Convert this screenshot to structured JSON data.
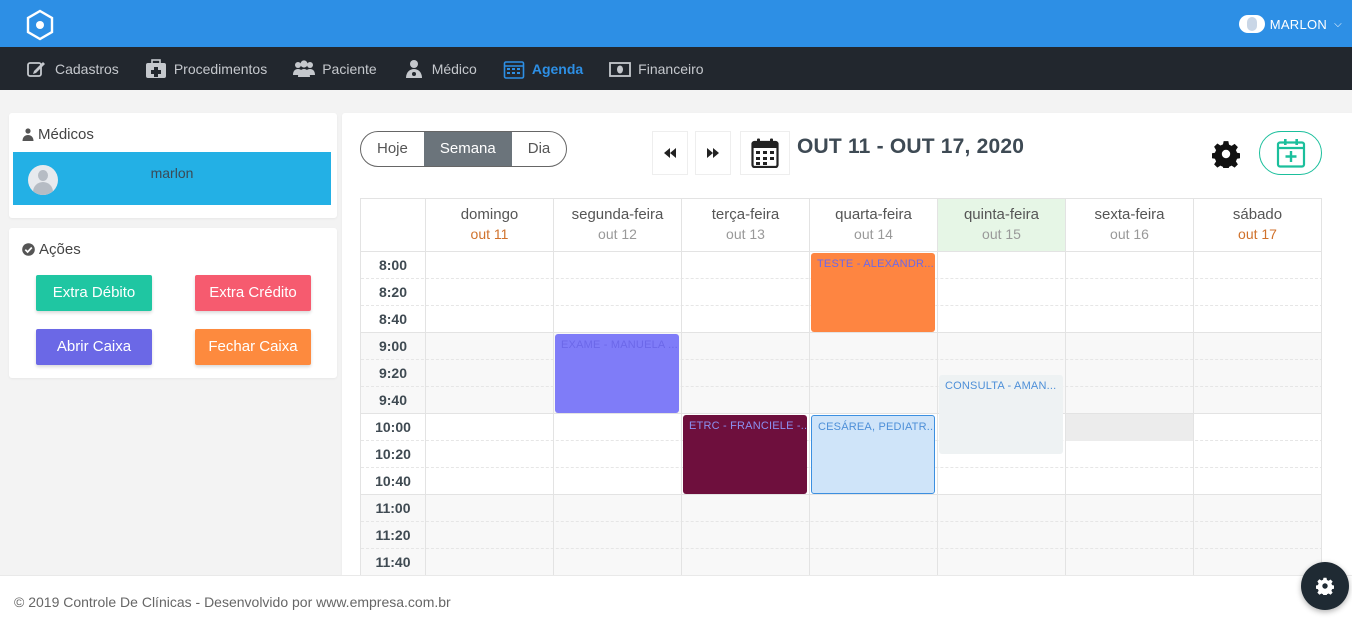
{
  "user": {
    "name": "MARLON"
  },
  "nav": [
    {
      "label": "Cadastros",
      "icon": "edit-icon"
    },
    {
      "label": "Procedimentos",
      "icon": "medkit-icon"
    },
    {
      "label": "Paciente",
      "icon": "users-icon"
    },
    {
      "label": "Médico",
      "icon": "doctor-icon"
    },
    {
      "label": "Agenda",
      "icon": "calendar-icon",
      "active": true
    },
    {
      "label": "Financeiro",
      "icon": "money-icon"
    }
  ],
  "medicos": {
    "title": "Médicos",
    "selected": "marlon"
  },
  "acoes": {
    "title": "Ações",
    "buttons": [
      {
        "label": "Extra Débito",
        "color": "#1fc6a2"
      },
      {
        "label": "Extra Crédito",
        "color": "#f65b6f"
      },
      {
        "label": "Abrir Caixa",
        "color": "#6b68e6"
      },
      {
        "label": "Fechar Caixa",
        "color": "#fd8a3e"
      }
    ]
  },
  "calendar": {
    "views": [
      "Hoje",
      "Semana",
      "Dia"
    ],
    "active_view": "Semana",
    "range": "OUT 11 - OUT 17, 2020",
    "days": [
      {
        "name": "domingo",
        "date": "out 11"
      },
      {
        "name": "segunda-feira",
        "date": "out 12"
      },
      {
        "name": "terça-feira",
        "date": "out 13"
      },
      {
        "name": "quarta-feira",
        "date": "out 14"
      },
      {
        "name": "quinta-feira",
        "date": "out 15",
        "today": true
      },
      {
        "name": "sexta-feira",
        "date": "out 16"
      },
      {
        "name": "sábado",
        "date": "out 17"
      }
    ],
    "times": [
      "8:00",
      "8:20",
      "8:40",
      "9:00",
      "9:20",
      "9:40",
      "10:00",
      "10:20",
      "10:40",
      "11:00",
      "11:20",
      "11:40"
    ],
    "events": [
      {
        "title": "TESTE - ALEXANDR...",
        "day": 3,
        "start": 0,
        "slots": 3,
        "bg": "#fe8541",
        "fg": "#6c68e9"
      },
      {
        "title": "EXAME - MANUELA ...",
        "day": 1,
        "start": 3,
        "slots": 3,
        "bg": "#7f7cf8",
        "fg": "#6c68e9"
      },
      {
        "title": "ETRC - FRANCIELE -...",
        "day": 2,
        "start": 6,
        "slots": 3,
        "bg": "#6e0f3d",
        "fg": "#8b90f0"
      },
      {
        "title": "CESÁREA, PEDIATR...",
        "day": 3,
        "start": 6,
        "slots": 3,
        "bg": "#cfe4f9",
        "fg": "#4d8fd8",
        "border": "#3c8fe0"
      },
      {
        "title": "CONSULTA - AMAN...",
        "day": 4,
        "start": 4.5,
        "slots": 3,
        "bg": "#eef2f3",
        "fg": "#4d8fd8"
      }
    ],
    "busy": {
      "day": 5,
      "start": 6,
      "slots": 1
    }
  },
  "footer": "© 2019 Controle De Clínicas - Desenvolvido por www.empresa.com.br"
}
